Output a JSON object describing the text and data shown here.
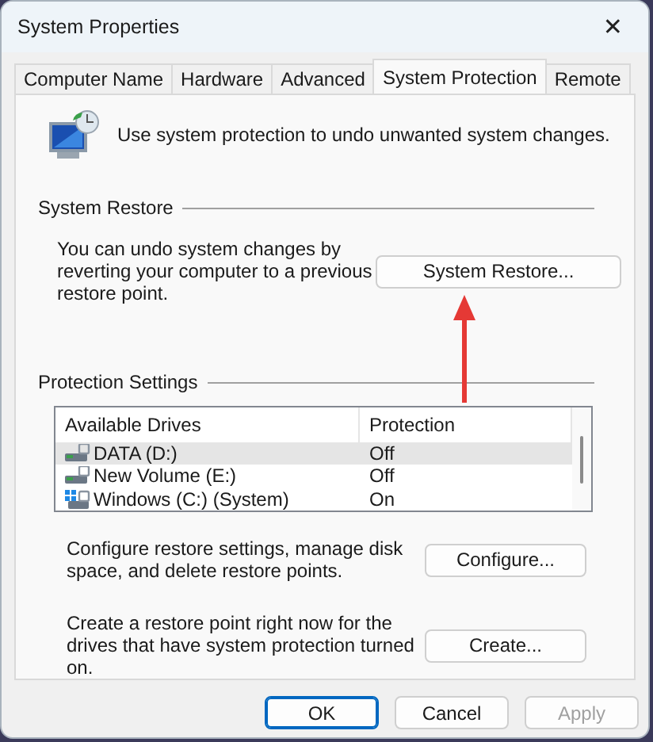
{
  "window": {
    "title": "System Properties",
    "close": "✕"
  },
  "tabs": [
    {
      "label": "Computer Name",
      "selected": false
    },
    {
      "label": "Hardware",
      "selected": false
    },
    {
      "label": "Advanced",
      "selected": false
    },
    {
      "label": "System Protection",
      "selected": true
    },
    {
      "label": "Remote",
      "selected": false
    }
  ],
  "intro": "Use system protection to undo unwanted system changes.",
  "system_restore": {
    "heading": "System Restore",
    "text": "You can undo system changes by reverting your computer to a previous restore point.",
    "button": "System Restore..."
  },
  "protection_settings": {
    "heading": "Protection Settings",
    "columns": [
      "Available Drives",
      "Protection"
    ],
    "rows": [
      {
        "kind": "drive",
        "name": "DATA (D:)",
        "protection": "Off",
        "selected": true
      },
      {
        "kind": "drive",
        "name": "New Volume (E:)",
        "protection": "Off",
        "selected": false
      },
      {
        "kind": "system",
        "name": "Windows (C:) (System)",
        "protection": "On",
        "selected": false
      }
    ]
  },
  "configure": {
    "text": "Configure restore settings, manage disk space, and delete restore points.",
    "button": "Configure..."
  },
  "create": {
    "text": "Create a restore point right now for the drives that have system protection turned on.",
    "button": "Create..."
  },
  "buttons": [
    {
      "label": "OK",
      "kind": "default",
      "disabled": false
    },
    {
      "label": "Cancel",
      "kind": "normal",
      "disabled": false
    },
    {
      "label": "Apply",
      "kind": "normal",
      "disabled": true
    }
  ]
}
